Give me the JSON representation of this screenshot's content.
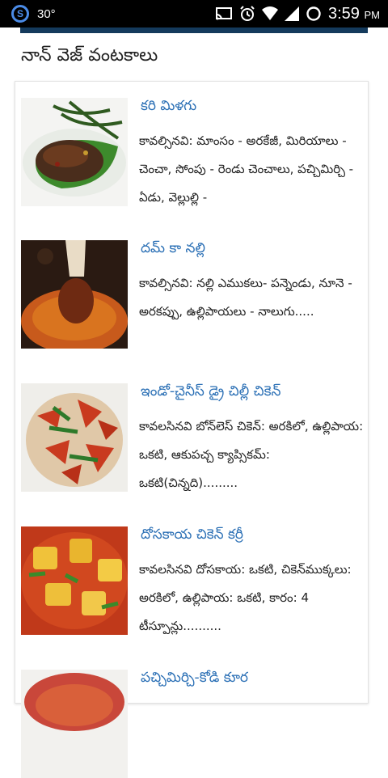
{
  "status_bar": {
    "app_badge": "S",
    "temperature": "30°",
    "time": "3:59",
    "ampm": "PM"
  },
  "page": {
    "section_title": "నాన్ వెజ్ వంటకాలు"
  },
  "recipes": [
    {
      "title": "కరి మిళగు",
      "description": "కావల్సినవి: మాంసం - అరకేజీ, మిరియాలు - చెంచా, సోంపు - రెండు చెంచాలు, పచ్చిమిర్చి - ఏడు, వెల్లుల్లి -"
    },
    {
      "title": "దమ్ కా నల్లి",
      "description": "కావల్సినవి: నల్లి ఎముకలు- పన్నెండు, నూనె - అరకప్పు, ఉల్లిపాయలు - నాలుగు....."
    },
    {
      "title": "ఇండో-చైనీస్ డ్రై చిల్లీ చికెన్",
      "description": "కావలసినవి బోన్‌లెస్ చికెన్: అరకిలో, ఉల్లిపాయ: ఒకటి, ఆకుపచ్చ క్యాప్సికమ్: ఒకటి(చిన్నది)........."
    },
    {
      "title": "దోసకాయ చికెన్ కర్రీ",
      "description": "కావలసినవి దోసకాయ: ఒకటి, చికెన్‌ముక్కలు: అరకిలో, ఉల్లిపాయ: ఒకటి, కారం: 4 టీస్పూన్లు.........."
    },
    {
      "title": "పచ్చిమిర్చి-కోడి కూర",
      "description": ""
    }
  ],
  "colors": {
    "title_link": "#2a6fb5",
    "app_bar": "#143a5c",
    "status_bar": "#000000"
  }
}
